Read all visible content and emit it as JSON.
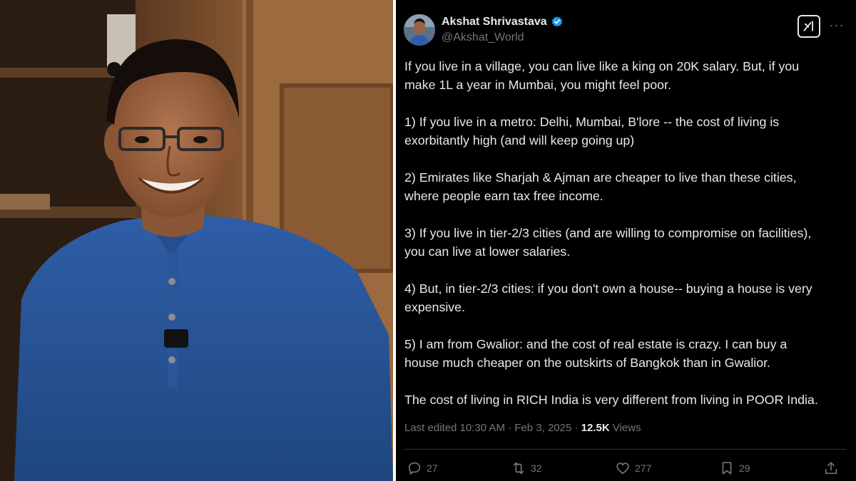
{
  "author": {
    "name": "Akshat Shrivastava",
    "handle": "@Akshat_World",
    "verified": true,
    "avatar_icon": "profile-photo"
  },
  "colors": {
    "verified_badge": "#1d9bf0",
    "text": "#e7e9ea",
    "muted": "#71767b",
    "background": "#000000"
  },
  "tweet": {
    "paragraphs": [
      [
        "If you live in a village, you can live like a king on 20K salary. But, if you",
        "make 1L a year in Mumbai, you might feel poor."
      ],
      [
        "1) If you live in a metro: Delhi, Mumbai, B'lore -- the cost of living is",
        "exorbitantly high (and will keep going up)"
      ],
      [
        "2) Emirates like Sharjah & Ajman are cheaper to live than these cities,",
        "where people earn tax free income."
      ],
      [
        "3) If you live in tier-2/3 cities (and are willing to compromise on facilities),",
        "you can live at lower salaries."
      ],
      [
        "4) But, in tier-2/3 cities: if you don't own a house-- buying a house is very",
        "expensive."
      ],
      [
        "5) I am from Gwalior: and the cost of real estate is crazy. I can buy a",
        "house much cheaper on the outskirts of Bangkok than in Gwalior."
      ],
      [
        "The cost of living in RICH India is very different from living in POOR India."
      ]
    ],
    "meta": {
      "edited": "Last edited 10:30 AM · Feb 3, 2025 · ",
      "views_count": "12.5K",
      "views_label": " Views"
    }
  },
  "actions": {
    "replies": "27",
    "reposts": "32",
    "likes": "277",
    "bookmarks": "29"
  },
  "icons": {
    "grok": "grok-icon",
    "more": "more-icon",
    "reply": "reply-icon",
    "repost": "repost-icon",
    "like": "heart-icon",
    "bookmark": "bookmark-icon",
    "share": "share-icon"
  }
}
